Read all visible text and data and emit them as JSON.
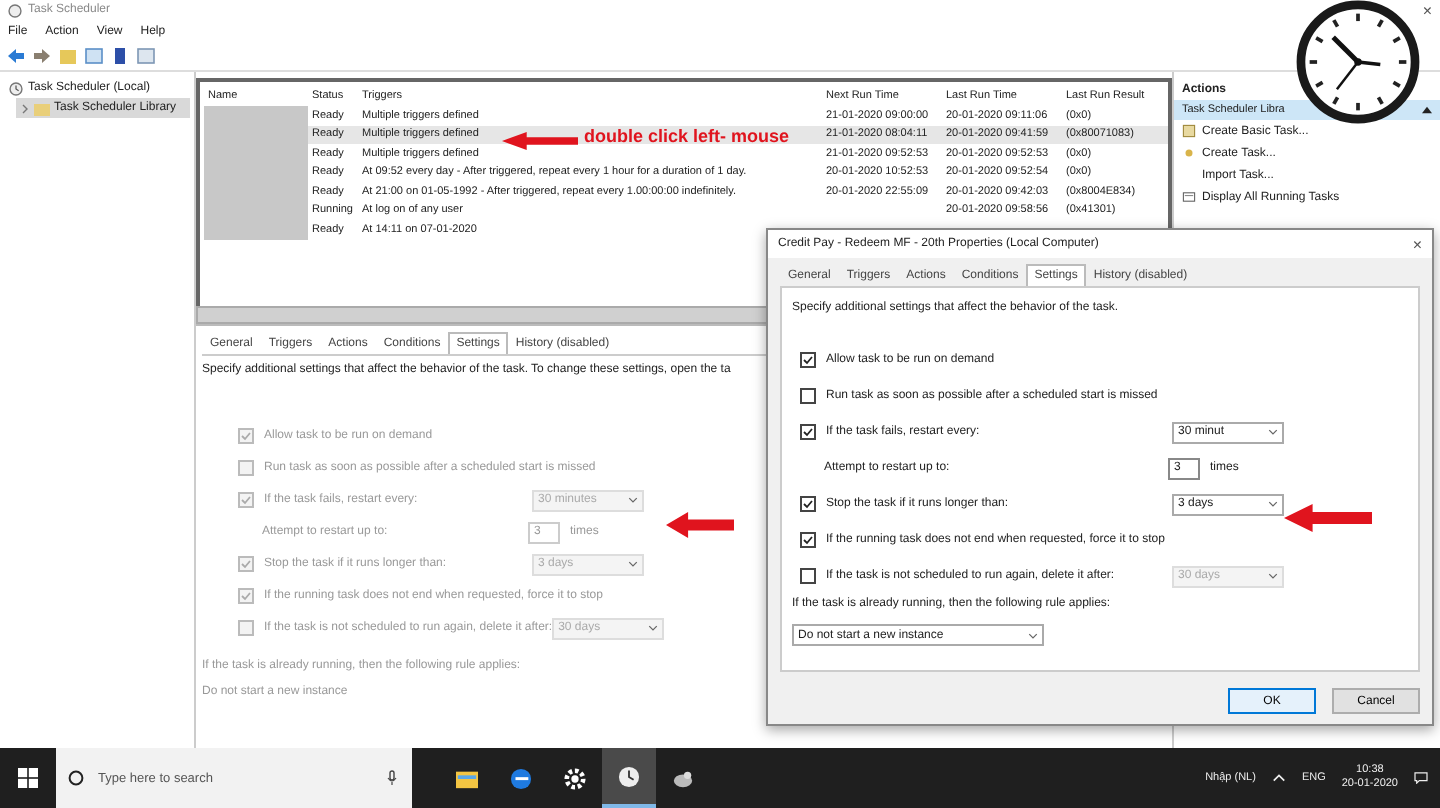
{
  "window": {
    "title": "Task Scheduler",
    "close": "×"
  },
  "menu": [
    "File",
    "Action",
    "View",
    "Help"
  ],
  "tree": [
    {
      "label": "Task Scheduler (Local)",
      "selected": false,
      "children": [
        {
          "label": "Task Scheduler Library",
          "selected": true
        }
      ]
    }
  ],
  "table": {
    "columns": [
      "Name",
      "Status",
      "Triggers",
      "Next Run Time",
      "Last Run Time",
      "Last Run Result"
    ],
    "rows": [
      {
        "status": "Ready",
        "triggers": "Multiple triggers defined",
        "next_run": "21-01-2020 09:00:00",
        "last_run": "20-01-2020 09:11:06",
        "result": "(0x0)",
        "selected": false
      },
      {
        "status": "Ready",
        "triggers": "Multiple triggers defined",
        "next_run": "21-01-2020 08:04:11",
        "last_run": "20-01-2020 09:41:59",
        "result": "(0x80071083)",
        "selected": true
      },
      {
        "status": "Ready",
        "triggers": "Multiple triggers defined",
        "next_run": "21-01-2020 09:52:53",
        "last_run": "20-01-2020 09:52:53",
        "result": "(0x0)",
        "selected": false
      },
      {
        "status": "Ready",
        "triggers": "At 09:52 every day - After triggered, repeat every 1 hour for a duration of 1 day.",
        "next_run": "20-01-2020 10:52:53",
        "last_run": "20-01-2020 09:52:54",
        "result": "(0x0)",
        "selected": false
      },
      {
        "status": "Ready",
        "triggers": "At 21:00 on 01-05-1992 - After triggered, repeat every 1.00:00:00 indefinitely.",
        "next_run": "20-01-2020 22:55:09",
        "last_run": "20-01-2020 09:42:03",
        "result": "(0x8004E834)",
        "selected": false
      },
      {
        "status": "Running",
        "triggers": "At log on of any user",
        "next_run": "",
        "last_run": "20-01-2020 09:58:56",
        "result": "(0x41301)",
        "selected": false
      },
      {
        "status": "Ready",
        "triggers": "At 14:11 on 07-01-2020",
        "next_run": "",
        "last_run": "",
        "result": "",
        "selected": false
      }
    ]
  },
  "annotation": "double click left- mouse",
  "actions": {
    "title": "Actions",
    "section": "Task Scheduler Libra",
    "items": [
      {
        "label": "Create Basic Task...",
        "kind": "wizard"
      },
      {
        "label": "Create Task...",
        "kind": "task"
      },
      {
        "label": "Import Task...",
        "kind": "plain"
      },
      {
        "label": "Display All Running Tasks",
        "kind": "list"
      }
    ]
  },
  "details": {
    "disabled": true,
    "tabs": [
      {
        "label": "General",
        "selected": false
      },
      {
        "label": "Triggers",
        "selected": false
      },
      {
        "label": "Actions",
        "selected": false
      },
      {
        "label": "Conditions",
        "selected": false
      },
      {
        "label": "Settings",
        "selected": true
      },
      {
        "label": "History (disabled)",
        "selected": false
      }
    ],
    "description": "Specify additional settings that affect the behavior of the task. To change these settings, open the ta",
    "settings": [
      {
        "kind": "check",
        "label": "Allow task to be run on demand",
        "checked": true
      },
      {
        "kind": "check",
        "label": "Run task as soon as possible after a scheduled start is missed",
        "checked": false
      },
      {
        "kind": "check",
        "label": "If the task fails, restart every:",
        "checked": true,
        "dropdown": {
          "value": "30 minutes",
          "disabled": true
        }
      },
      {
        "kind": "count",
        "label": "Attempt to restart up to:",
        "value": "3",
        "unit": "times"
      },
      {
        "kind": "check",
        "label": "Stop the task if it runs longer than:",
        "checked": true,
        "dropdown": {
          "value": "3 days",
          "disabled": true
        }
      },
      {
        "kind": "check",
        "label": "If the running task does not end when requested, force it to stop",
        "checked": true
      },
      {
        "kind": "check",
        "label": "If the task is not scheduled to run again, delete it after:",
        "checked": false,
        "dropdown": {
          "value": "30 days",
          "disabled": true
        }
      }
    ],
    "rule_label": "If the task is already running, then the following rule applies:",
    "rule_value": "Do not start a new instance"
  },
  "dialog": {
    "title": "Credit Pay - Redeem MF - 20th Properties (Local Computer)",
    "close": "×",
    "disabled": false,
    "tabs": [
      {
        "label": "General",
        "selected": false
      },
      {
        "label": "Triggers",
        "selected": false
      },
      {
        "label": "Actions",
        "selected": false
      },
      {
        "label": "Conditions",
        "selected": false
      },
      {
        "label": "Settings",
        "selected": true
      },
      {
        "label": "History (disabled)",
        "selected": false
      }
    ],
    "description": "Specify additional settings that affect the behavior of the task.",
    "settings": [
      {
        "kind": "check",
        "label": "Allow task to be run on demand",
        "checked": true
      },
      {
        "kind": "check",
        "label": "Run task as soon as possible after a scheduled start is missed",
        "checked": false
      },
      {
        "kind": "check",
        "label": "If the task fails, restart every:",
        "checked": true,
        "dropdown": {
          "value": "30 minut",
          "disabled": false
        }
      },
      {
        "kind": "count",
        "label": "Attempt to restart up to:",
        "value": "3",
        "unit": "times"
      },
      {
        "kind": "check",
        "label": "Stop the task if it runs longer than:",
        "checked": true,
        "dropdown": {
          "value": "3 days",
          "disabled": false
        }
      },
      {
        "kind": "check",
        "label": "If the running task does not end when requested, force it to stop",
        "checked": true
      },
      {
        "kind": "check",
        "label": "If the task is not scheduled to run again, delete it after:",
        "checked": false,
        "dropdown": {
          "value": "30 days",
          "disabled": true
        }
      }
    ],
    "rule_label": "If the task is already running, then the following rule applies:",
    "rule_value": "Do not start a new instance",
    "buttons": [
      {
        "label": "OK",
        "default": true
      },
      {
        "label": "Cancel",
        "default": false
      }
    ]
  },
  "taskbar": {
    "search": {
      "placeholder": "Type here to search"
    },
    "apps": [
      {
        "kind": "folder",
        "selected": false
      },
      {
        "kind": "browser",
        "selected": false
      },
      {
        "kind": "gear",
        "selected": false
      },
      {
        "kind": "clock",
        "selected": true
      },
      {
        "kind": "bird",
        "selected": false
      }
    ],
    "ime": "Nhập (NL)",
    "language": "ENG",
    "time": "10:38",
    "date": "20-01-2020"
  }
}
